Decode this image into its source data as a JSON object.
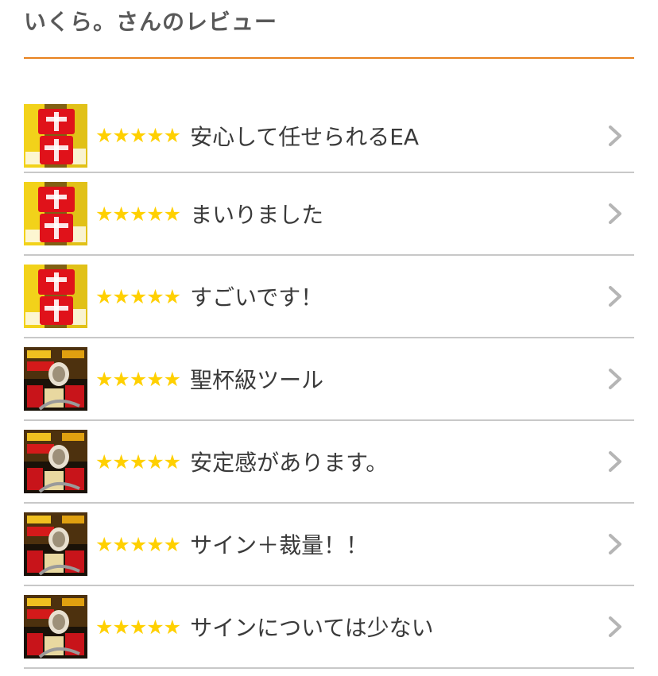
{
  "page": {
    "title": "いくら。さんのレビュー"
  },
  "colors": {
    "accent": "#e8821e",
    "star": "#ffd000",
    "divider": "#c8c8c8",
    "chevron": "#b5b5b5"
  },
  "reviews": [
    {
      "stars": "★★★★★",
      "rating": 5,
      "title": "安心して任せられるEA",
      "thumb": "sold-out-banner"
    },
    {
      "stars": "★★★★★",
      "rating": 5,
      "title": "まいりました",
      "thumb": "sold-out-banner"
    },
    {
      "stars": "★★★★★",
      "rating": 5,
      "title": "すごいです！",
      "thumb": "sold-out-banner"
    },
    {
      "stars": "★★★★★",
      "rating": 5,
      "title": "聖杯級ツール",
      "thumb": "tiger-banner"
    },
    {
      "stars": "★★★★★",
      "rating": 5,
      "title": "安定感があります。",
      "thumb": "tiger-banner"
    },
    {
      "stars": "★★★★★",
      "rating": 5,
      "title": "サイン＋裁量！！",
      "thumb": "tiger-banner"
    },
    {
      "stars": "★★★★★",
      "rating": 5,
      "title": "サインについては少ない",
      "thumb": "tiger-banner"
    }
  ]
}
